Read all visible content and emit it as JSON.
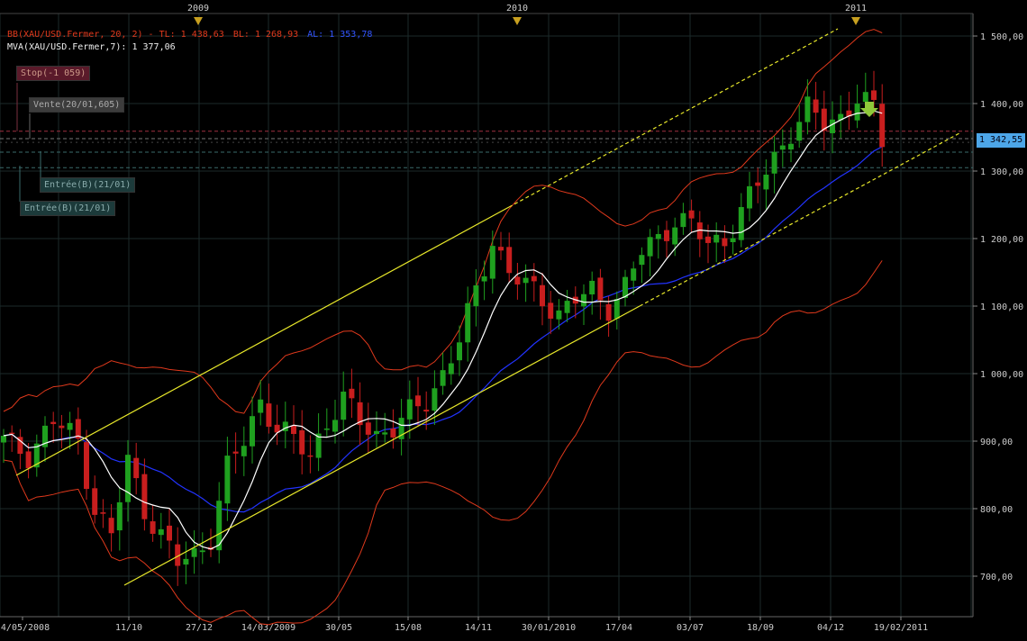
{
  "chart_data": {
    "type": "candlestick",
    "instrument": "XAU/USD",
    "legend": {
      "bb_prefix": "BB(XAU/USD.Fermer, 20, 2) - TL: 1 438,63",
      "bb_bl": "BL: 1 268,93",
      "bb_al": "AL: 1 353,78",
      "mva": "MVA(XAU/USD.Fermer,7): 1 377,06"
    },
    "x_labels": [
      "24/05/2008",
      "11/10",
      "27/12",
      "14/03/2009",
      "30/05",
      "15/08",
      "14/11",
      "30/01/2010",
      "17/04",
      "03/07",
      "18/09",
      "04/12",
      "19/02/2011"
    ],
    "year_markers": [
      "2009",
      "2010",
      "2011"
    ],
    "y_ticks": [
      "1 500,00",
      "1 400,00",
      "1 300,00",
      "1 200,00",
      "1 100,00",
      "1 000,00",
      "900,00",
      "800,00",
      "700,00"
    ],
    "y_range": [
      700,
      1500
    ],
    "current_price": "1 342,55",
    "order_tags": {
      "stop": "Stop(-1 059)",
      "vente": "Vente(20/01,605)",
      "entree_1": "Entrée(B)(21/01)",
      "entree_2": "Entrée(B)(21/01)"
    },
    "colors": {
      "bull": "#1fa01f",
      "bear": "#c81e1e",
      "bollinger": "#e0391c",
      "mva": "#ffffff",
      "ma_blue": "#2233ff",
      "channel": "#e8e82a",
      "current_price": "#4da6e8"
    },
    "price_path": [
      [
        0,
        900
      ],
      [
        3,
        880
      ],
      [
        6,
        930
      ],
      [
        9,
        900
      ],
      [
        11,
        800
      ],
      [
        13,
        760
      ],
      [
        15,
        870
      ],
      [
        17,
        800
      ],
      [
        19,
        760
      ],
      [
        21,
        720
      ],
      [
        23,
        730
      ],
      [
        25,
        760
      ],
      [
        27,
        860
      ],
      [
        29,
        900
      ],
      [
        31,
        960
      ],
      [
        33,
        920
      ],
      [
        35,
        900
      ],
      [
        37,
        880
      ],
      [
        39,
        930
      ],
      [
        41,
        960
      ],
      [
        43,
        930
      ],
      [
        45,
        910
      ],
      [
        47,
        920
      ],
      [
        49,
        940
      ],
      [
        51,
        960
      ],
      [
        53,
        1000
      ],
      [
        55,
        1050
      ],
      [
        57,
        1120
      ],
      [
        59,
        1200
      ],
      [
        61,
        1150
      ],
      [
        63,
        1130
      ],
      [
        65,
        1110
      ],
      [
        67,
        1090
      ],
      [
        69,
        1110
      ],
      [
        71,
        1120
      ],
      [
        73,
        1100
      ],
      [
        75,
        1130
      ],
      [
        77,
        1180
      ],
      [
        79,
        1200
      ],
      [
        81,
        1230
      ],
      [
        83,
        1220
      ],
      [
        85,
        1190
      ],
      [
        87,
        1200
      ],
      [
        89,
        1240
      ],
      [
        91,
        1280
      ],
      [
        93,
        1320
      ],
      [
        95,
        1360
      ],
      [
        97,
        1390
      ],
      [
        99,
        1370
      ],
      [
        101,
        1380
      ],
      [
        103,
        1410
      ],
      [
        105,
        1390
      ],
      [
        106,
        1345
      ]
    ]
  }
}
